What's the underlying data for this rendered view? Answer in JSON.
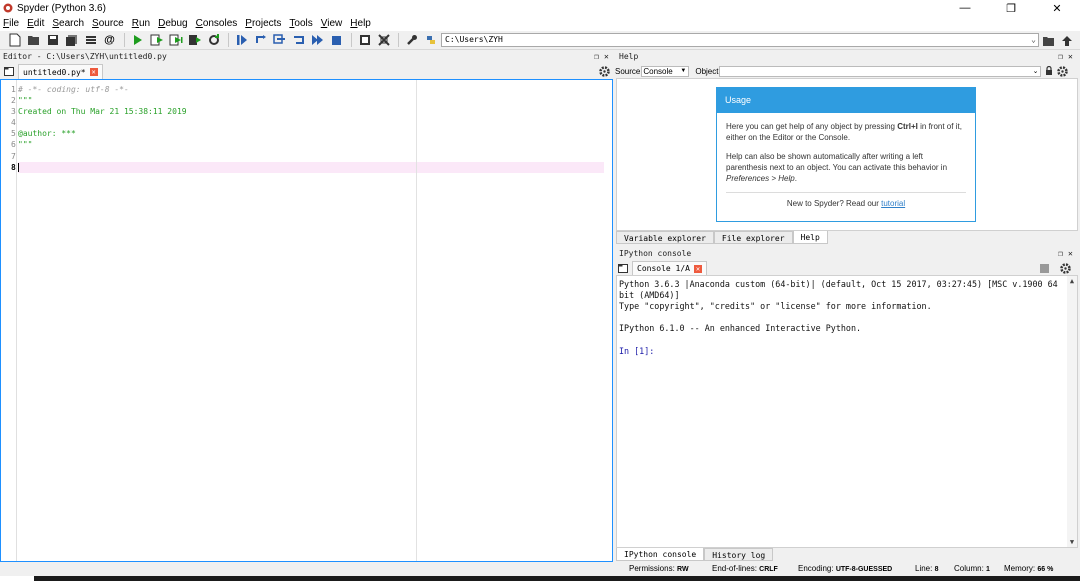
{
  "window": {
    "title": "Spyder (Python 3.6)",
    "minimize": "—",
    "maximize": "❐",
    "close": "✕"
  },
  "menu": [
    "File",
    "Edit",
    "Search",
    "Source",
    "Run",
    "Debug",
    "Consoles",
    "Projects",
    "Tools",
    "View",
    "Help"
  ],
  "toolbar": {
    "working_dir": "C:\\Users\\ZYH"
  },
  "editor": {
    "header": "Editor - C:\\Users\\ZYH\\untitled0.py",
    "tab_label": "untitled0.py*",
    "lines": [
      {
        "num": "1",
        "text": "# -*- coding: utf-8 -*-"
      },
      {
        "num": "2",
        "text": "\"\"\""
      },
      {
        "num": "3",
        "text": "Created on Thu Mar 21 15:38:11 2019"
      },
      {
        "num": "4",
        "text": ""
      },
      {
        "num": "5",
        "text": "@author: ***"
      },
      {
        "num": "6",
        "text": "\"\"\""
      },
      {
        "num": "7",
        "text": ""
      },
      {
        "num": "8",
        "text": ""
      }
    ]
  },
  "help": {
    "header": "Help",
    "source_label": "Source",
    "source_value": "Console",
    "object_label": "Object",
    "usage_title": "Usage",
    "usage_p1_a": "Here you can get help of any object by pressing ",
    "usage_p1_key": "Ctrl+I",
    "usage_p1_b": " in front of it, either on the Editor or the Console.",
    "usage_p2_a": "Help can also be shown automatically after writing a left parenthesis next to an object. You can activate this behavior in ",
    "usage_p2_em": "Preferences > Help",
    "usage_p2_b": ".",
    "usage_foot": "New to Spyder? Read our ",
    "usage_link": "tutorial"
  },
  "help_tabs": [
    "Variable explorer",
    "File explorer",
    "Help"
  ],
  "console": {
    "header": "IPython console",
    "tab_label": "Console 1/A",
    "lines": [
      "Python 3.6.3 |Anaconda custom (64-bit)| (default, Oct 15 2017, 03:27:45) [MSC v.1900 64",
      "bit (AMD64)]",
      "Type \"copyright\", \"credits\" or \"license\" for more information.",
      "",
      "IPython 6.1.0 -- An enhanced Interactive Python.",
      ""
    ],
    "prompt": "In [1]:"
  },
  "console_tabs": [
    "IPython console",
    "History log"
  ],
  "status": {
    "permissions_label": "Permissions:",
    "permissions_value": "RW",
    "eol_label": "End-of-lines:",
    "eol_value": "CRLF",
    "encoding_label": "Encoding:",
    "encoding_value": "UTF-8-GUESSED",
    "line_label": "Line:",
    "line_value": "8",
    "column_label": "Column:",
    "column_value": "1",
    "memory_label": "Memory:",
    "memory_value": "66 %"
  },
  "colors": {
    "accent": "#2f9ce0",
    "focus_border": "#1e90ff",
    "current_line": "#fbe8f8",
    "code_green": "#2aa12a"
  }
}
